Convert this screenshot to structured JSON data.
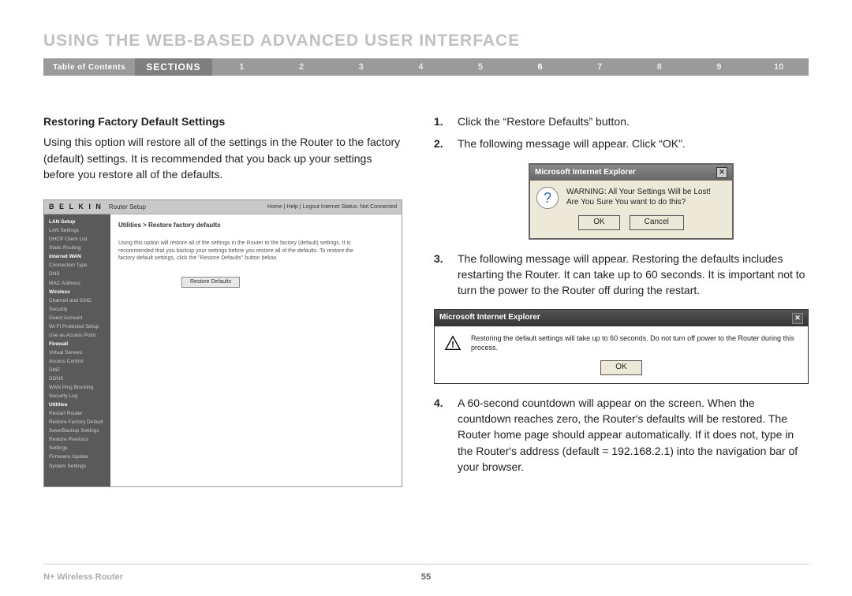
{
  "title": "USING THE WEB-BASED ADVANCED USER INTERFACE",
  "nav": {
    "toc": "Table of Contents",
    "sections": "SECTIONS",
    "nums": [
      "1",
      "2",
      "3",
      "4",
      "5",
      "6",
      "7",
      "8",
      "9",
      "10"
    ],
    "active": "6"
  },
  "left": {
    "heading": "Restoring Factory Default Settings",
    "para": "Using this option will restore all of the settings in the Router to the factory (default) settings. It is recommended that you back up your settings before you restore all of the defaults."
  },
  "router": {
    "logo": "B E L K I N",
    "subtitle": "Router Setup",
    "toolbar": "Home | Help | Logout    Internet Status: Not Connected",
    "side": [
      {
        "t": "LAN Setup",
        "hd": true
      },
      {
        "t": "LAN Settings"
      },
      {
        "t": "DHCP Client List"
      },
      {
        "t": "Static Routing"
      },
      {
        "t": "Internet WAN",
        "hd": true
      },
      {
        "t": "Connection Type"
      },
      {
        "t": "DNS"
      },
      {
        "t": "MAC Address"
      },
      {
        "t": "Wireless",
        "hd": true
      },
      {
        "t": "Channel and SSID"
      },
      {
        "t": "Security"
      },
      {
        "t": "Guest Account"
      },
      {
        "t": "Wi-Fi Protected Setup"
      },
      {
        "t": "Use as Access Point"
      },
      {
        "t": "Firewall",
        "hd": true
      },
      {
        "t": "Virtual Servers"
      },
      {
        "t": "Access Control"
      },
      {
        "t": "DMZ"
      },
      {
        "t": "DDNS"
      },
      {
        "t": "WAN Ping Blocking"
      },
      {
        "t": "Security Log"
      },
      {
        "t": "Utilities",
        "hd": true
      },
      {
        "t": "Restart Router"
      },
      {
        "t": "Restore Factory Default"
      },
      {
        "t": "Save/Backup Settings"
      },
      {
        "t": "Restore Previous Settings"
      },
      {
        "t": "Firmware Update"
      },
      {
        "t": "System Settings"
      }
    ],
    "crumb": "Utilities > Restore factory defaults",
    "desc": "Using this option will restore all of the settings in the Router to the factory (default) settings. It is recommended that you backup your settings before you restore all of the defaults. To restore the factory default settings, click the \"Restore Defaults\" button below.",
    "btn": "Restore Defaults"
  },
  "steps": {
    "s1": "Click the “Restore Defaults” button.",
    "s2": "The following message will appear. Click “OK”.",
    "s3": "The following message will appear. Restoring the defaults includes restarting the Router. It can take up to 60 seconds. It is important not to turn the power to the Router off during the restart.",
    "s4": "A 60-second countdown will appear on the screen. When the countdown reaches zero, the Router's defaults will be restored. The Router home page should appear automatically. If it does not, type in the Router's address (default = 192.168.2.1) into the navigation bar of your browser."
  },
  "dlg1": {
    "title": "Microsoft Internet Explorer",
    "line1": "WARNING: All Your Settings Will be Lost!",
    "line2": "Are You Sure You want to do this?",
    "ok": "OK",
    "cancel": "Cancel"
  },
  "dlg2": {
    "title": "Microsoft Internet Explorer",
    "msg": "Restoring the default settings will take up to 60 seconds. Do not turn off power to the Router during this process.",
    "ok": "OK"
  },
  "footer": {
    "product": "N+ Wireless Router",
    "page": "55"
  }
}
